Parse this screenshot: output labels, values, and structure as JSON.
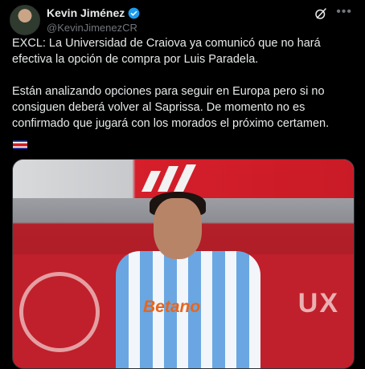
{
  "author": {
    "name": "Kevin Jiménez",
    "handle": "@KevinJimenezCR"
  },
  "icons": {
    "verified": "verified-badge-icon",
    "grok": "grok-icon",
    "more": "more-options-icon",
    "flag": "costa-rica-flag-icon"
  },
  "colors": {
    "verified": "#1d9bf0",
    "background": "#000000",
    "text": "#e7e9ea",
    "secondary": "#71767b"
  },
  "tweet": {
    "paragraph1": "EXCL: La Universidad de Craiova ya comunicó que no hará efectiva la opción de compra por Luis Paradela.",
    "paragraph2": "Están analizando opciones para seguir en Europa pero si no consiguen deberá volver al Saprissa. De momento no es confirmado que jugará con los morados el próximo certamen."
  },
  "media": {
    "sponsor_text": "Betano",
    "board_text": "UX"
  }
}
